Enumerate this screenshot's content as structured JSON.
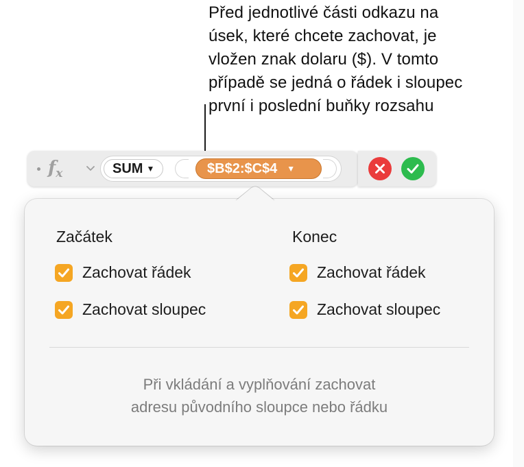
{
  "callout": {
    "lines": [
      "Před jednotlivé části odkazu na",
      "úsek, které chcete zachovat, je",
      "vložen znak dolaru ($). V tomto",
      "případě se jedná o řádek i sloupec",
      "první i poslední buňky rozsahu"
    ]
  },
  "formula_bar": {
    "fx_label": "f",
    "fx_sub": "x",
    "function_token": "SUM",
    "range_token": "$B$2:$C$4",
    "cancel_icon": "close-icon",
    "accept_icon": "checkmark-icon",
    "cancel_color": "#ea3c3c",
    "accept_color": "#2dbb4e",
    "range_color": "#e8944b"
  },
  "popover": {
    "start": {
      "heading": "Začátek",
      "options": [
        {
          "label": "Zachovat řádek",
          "checked": true
        },
        {
          "label": "Zachovat sloupec",
          "checked": true
        }
      ]
    },
    "end": {
      "heading": "Konec",
      "options": [
        {
          "label": "Zachovat řádek",
          "checked": true
        },
        {
          "label": "Zachovat sloupec",
          "checked": true
        }
      ]
    },
    "footer_lines": [
      "Při vkládání a vyplňování zachovat",
      "adresu původního sloupce nebo řádku"
    ],
    "checkbox_color": "#f5a623"
  }
}
